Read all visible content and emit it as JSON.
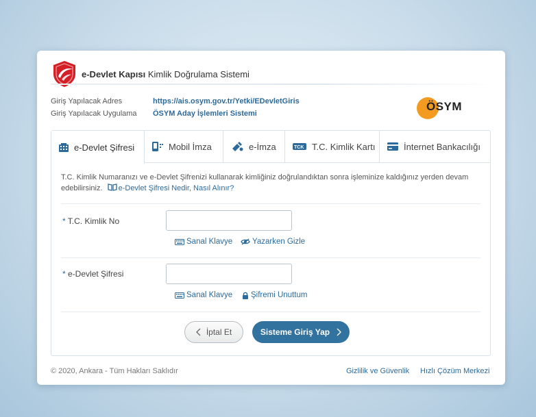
{
  "header": {
    "brand_bold": "e-Devlet Kapısı",
    "brand_rest": " Kimlik Doğrulama Sistemi"
  },
  "info": {
    "address_label": "Giriş Yapılacak Adres",
    "address_value": "https://ais.osym.gov.tr/Yetki/EDevletGiris",
    "app_label": "Giriş Yapılacak Uygulama",
    "app_value": "ÖSYM Aday İşlemleri Sistemi"
  },
  "osym_logo_text": "ÖSYM",
  "tabs": [
    {
      "label": "e-Devlet Şifresi",
      "active": true
    },
    {
      "label": "Mobil İmza"
    },
    {
      "label": "e-İmza"
    },
    {
      "label": "T.C. Kimlik Kartı"
    },
    {
      "label": "İnternet Bankacılığı"
    }
  ],
  "description": {
    "text": "T.C. Kimlik Numaranızı ve e-Devlet Şifrenizi kullanarak kimliğiniz doğrulandıktan sonra işleminize kaldığınız yerden devam edebilirsiniz.",
    "link": "e-Devlet Şifresi Nedir, Nasıl Alınır?"
  },
  "form": {
    "tc": {
      "required": "*",
      "label": "T.C. Kimlik No",
      "value": "",
      "keyboard": "Sanal Klavye",
      "hide": "Yazarken Gizle"
    },
    "password": {
      "required": "*",
      "label": "e-Devlet Şifresi",
      "value": "",
      "keyboard": "Sanal Klavye",
      "forgot": "Şifremi Unuttum"
    }
  },
  "buttons": {
    "cancel": "İptal Et",
    "submit": "Sisteme Giriş Yap"
  },
  "footer": {
    "copyright": "© 2020, Ankara - Tüm Hakları Saklıdır",
    "privacy": "Gizlilik ve Güvenlik",
    "help": "Hızlı Çözüm Merkezi"
  },
  "colors": {
    "accent": "#32729f",
    "link": "#2c6a9b",
    "logo_red": "#d31f26",
    "osym_orange": "#f39a21"
  }
}
